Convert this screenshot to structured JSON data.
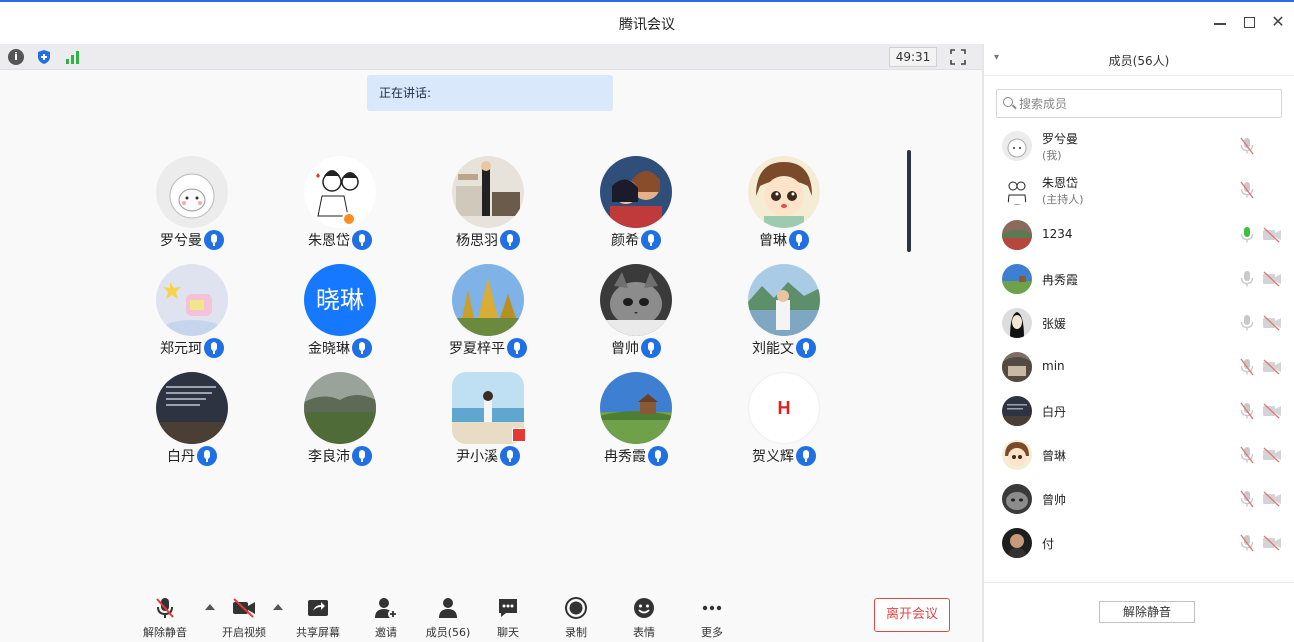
{
  "window": {
    "title": "腾讯会议"
  },
  "stage": {
    "timer": "49:31",
    "speaking_label": "正在讲话:"
  },
  "participants": [
    {
      "name": "罗兮曼",
      "avatar": "sheep-cartoon"
    },
    {
      "name": "朱恩岱",
      "avatar": "sketch-couple",
      "host": true
    },
    {
      "name": "杨思羽",
      "avatar": "kitchen-photo"
    },
    {
      "name": "颜希",
      "avatar": "embrace-illustration"
    },
    {
      "name": "曾琳",
      "avatar": "girl-cartoon"
    },
    {
      "name": "郑元珂",
      "avatar": "pastel-cartoon"
    },
    {
      "name": "金晓琳",
      "avatar": "text",
      "avatar_text": "晓琳"
    },
    {
      "name": "罗夏梓平",
      "avatar": "temple-photo"
    },
    {
      "name": "曾帅",
      "avatar": "cat-bw-photo"
    },
    {
      "name": "刘能文",
      "avatar": "lake-photo"
    },
    {
      "name": "白丹",
      "avatar": "quote-night-photo"
    },
    {
      "name": "李良沛",
      "avatar": "field-photo"
    },
    {
      "name": "尹小溪",
      "avatar": "beach-photo"
    },
    {
      "name": "冉秀霞",
      "avatar": "meadow-photo"
    },
    {
      "name": "贺义辉",
      "avatar": "h-logo",
      "avatar_text": "H"
    }
  ],
  "toolbar": {
    "unmute": "解除静音",
    "start_video": "开启视频",
    "share_screen": "共享屏幕",
    "invite": "邀请",
    "members": "成员(56)",
    "chat": "聊天",
    "record": "录制",
    "reactions": "表情",
    "more": "更多",
    "leave": "离开会议"
  },
  "panel": {
    "title": "成员(56人)",
    "search_placeholder": "搜索成员",
    "unmute_all": "解除静音",
    "members": [
      {
        "name": "罗兮曼",
        "sub": "(我)",
        "mic": "muted",
        "cam": "none"
      },
      {
        "name": "朱恩岱",
        "sub": "(主持人)",
        "mic": "muted",
        "cam": "none"
      },
      {
        "name": "1234",
        "sub": "",
        "mic": "active",
        "cam": "off"
      },
      {
        "name": "冉秀霞",
        "sub": "",
        "mic": "on",
        "cam": "off"
      },
      {
        "name": "张媛",
        "sub": "",
        "mic": "on",
        "cam": "off"
      },
      {
        "name": "min",
        "sub": "",
        "mic": "muted",
        "cam": "off"
      },
      {
        "name": "白丹",
        "sub": "",
        "mic": "muted",
        "cam": "off"
      },
      {
        "name": "曾琳",
        "sub": "",
        "mic": "muted",
        "cam": "off"
      },
      {
        "name": "曾帅",
        "sub": "",
        "mic": "muted",
        "cam": "off"
      },
      {
        "name": "付",
        "sub": "",
        "mic": "muted",
        "cam": "off"
      }
    ]
  },
  "colors": {
    "accent": "#1f6fe5",
    "leave": "#e04848",
    "active_mic": "#3cc13b"
  }
}
